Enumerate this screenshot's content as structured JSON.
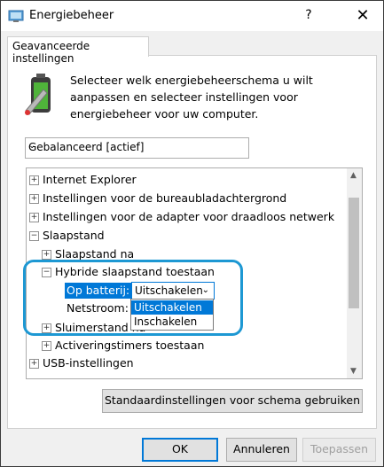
{
  "window": {
    "title": "Energiebeheer",
    "help": "?",
    "close": "✕"
  },
  "tab": {
    "label": "Geavanceerde instellingen"
  },
  "description": "Selecteer welk energiebeheerschema u wilt aanpassen en selecteer instellingen voor energiebeheer voor uw computer.",
  "plan_dropdown": {
    "value": "Gebalanceerd [actief]"
  },
  "tree": {
    "items": [
      {
        "label": "Internet Explorer",
        "expander": "+"
      },
      {
        "label": "Instellingen voor de bureaubladachtergrond",
        "expander": "+"
      },
      {
        "label": "Instellingen voor de adapter voor draadloos netwerk",
        "expander": "+"
      },
      {
        "label": "Slaapstand",
        "expander": "−"
      },
      {
        "label": "Slaapstand na",
        "expander": "+"
      },
      {
        "label": "Hybride slaapstand toestaan",
        "expander": "−"
      },
      {
        "label": "Sluimerstand na",
        "expander": "+"
      },
      {
        "label": "Activeringstimers toestaan",
        "expander": "+"
      },
      {
        "label": "USB-instellingen",
        "expander": "+"
      }
    ],
    "battery_label": "Op batterij:",
    "battery_value": "Uitschakelen",
    "net_label": "Netstroom:",
    "options": [
      "Uitschakelen",
      "Inschakelen"
    ]
  },
  "buttons": {
    "restore_defaults": "Standaardinstellingen voor schema gebruiken",
    "ok": "OK",
    "cancel": "Annuleren",
    "apply": "Toepassen"
  }
}
